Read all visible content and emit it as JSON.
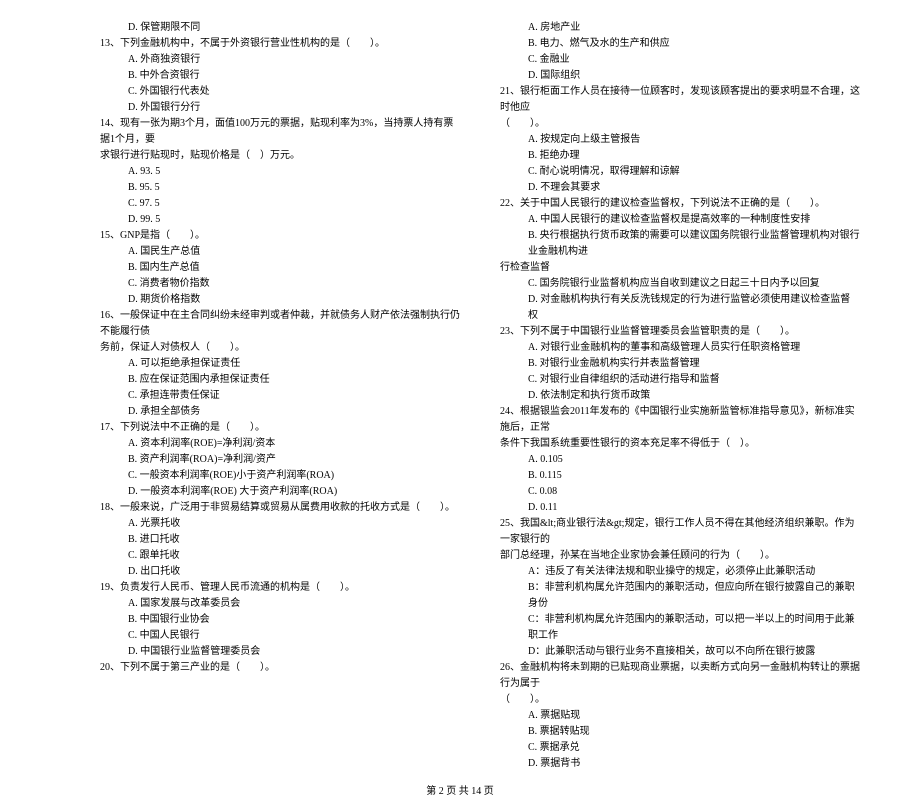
{
  "left": {
    "q12_d": "D. 保管期限不同",
    "q13": "13、下列金融机构中，不属于外资银行营业性机构的是（　　）。",
    "q13_a": "A. 外商独资银行",
    "q13_b": "B. 中外合资银行",
    "q13_c": "C. 外国银行代表处",
    "q13_d": "D. 外国银行分行",
    "q14": "14、现有一张为期3个月，面值100万元的票据，贴现利率为3%，当持票人持有票据1个月，要",
    "q14_cont": "求银行进行贴现时，贴现价格是（　）万元。",
    "q14_a": "A. 93. 5",
    "q14_b": "B. 95. 5",
    "q14_c": "C. 97. 5",
    "q14_d": "D. 99. 5",
    "q15": "15、GNP是指（　　）。",
    "q15_a": "A. 国民生产总值",
    "q15_b": "B. 国内生产总值",
    "q15_c": "C. 消费者物价指数",
    "q15_d": "D. 期货价格指数",
    "q16": "16、一般保证中在主合同纠纷未经审判或者仲裁，并就债务人财产依法强制执行仍不能履行债",
    "q16_cont": "务前，保证人对债权人（　　）。",
    "q16_a": "A. 可以拒绝承担保证责任",
    "q16_b": "B. 应在保证范围内承担保证责任",
    "q16_c": "C. 承担连带责任保证",
    "q16_d": "D. 承担全部债务",
    "q17": "17、下列说法中不正确的是（　　）。",
    "q17_a": "A. 资本利润率(ROE)=净利润/资本",
    "q17_b": "B. 资产利润率(ROA)=净利润/资产",
    "q17_c": "C. 一般资本利润率(ROE)小于资产利润率(ROA)",
    "q17_d": "D. 一般资本利润率(ROE) 大于资产利润率(ROA)",
    "q18": "18、一般来说，广泛用于非贸易结算或贸易从属费用收款的托收方式是（　　）。",
    "q18_a": "A. 光票托收",
    "q18_b": "B. 进口托收",
    "q18_c": "C. 跟单托收",
    "q18_d": "D. 出口托收",
    "q19": "19、负责发行人民币、管理人民币流通的机构是（　　）。",
    "q19_a": "A. 国家发展与改革委员会",
    "q19_b": "B. 中国银行业协会",
    "q19_c": "C. 中国人民银行",
    "q19_d": "D. 中国银行业监督管理委员会",
    "q20": "20、下列不属于第三产业的是（　　）。"
  },
  "right": {
    "q20_a": "A. 房地产业",
    "q20_b": "B. 电力、燃气及水的生产和供应",
    "q20_c": "C. 金融业",
    "q20_d": "D. 国际组织",
    "q21": "21、银行柜面工作人员在接待一位顾客时，发现该顾客提出的要求明显不合理，这时他应",
    "q21_cont": "（　　）。",
    "q21_a": "A. 按规定向上级主管报告",
    "q21_b": "B. 拒绝办理",
    "q21_c": "C. 耐心说明情况，取得理解和谅解",
    "q21_d": "D. 不理会其要求",
    "q22": "22、关于中国人民银行的建议检查监督权，下列说法不正确的是（　　）。",
    "q22_a": "A. 中国人民银行的建议检查监督权是提高效率的一种制度性安排",
    "q22_b": "B. 央行根据执行货币政策的需要可以建议国务院银行业监督管理机构对银行业金融机构进",
    "q22_b_cont": "行检查监督",
    "q22_c": "C. 国务院银行业监督机构应当自收到建议之日起三十日内予以回复",
    "q22_d": "D. 对金融机构执行有关反洗钱规定的行为进行监管必须使用建议检查监督权",
    "q23": "23、下列不属于中国银行业监督管理委员会监管职责的是（　　）。",
    "q23_a": "A. 对银行业金融机构的董事和高级管理人员实行任职资格管理",
    "q23_b": "B. 对银行业金融机构实行并表监督管理",
    "q23_c": "C. 对银行业自律组织的活动进行指导和监督",
    "q23_d": "D. 依法制定和执行货币政策",
    "q24": "24、根据银监会2011年发布的《中国银行业实施新监管标准指导意见》，新标准实施后，正常",
    "q24_cont": "条件下我国系统重要性银行的资本充足率不得低于（　）。",
    "q24_a": "A. 0.105",
    "q24_b": "B. 0.115",
    "q24_c": "C. 0.08",
    "q24_d": "D. 0.11",
    "q25": "25、我国&lt;商业银行法&gt;规定，银行工作人员不得在其他经济组织兼职。作为一家银行的",
    "q25_cont": "部门总经理，孙某在当地企业家协会兼任顾问的行为（　　）。",
    "q25_a": "A：违反了有关法律法规和职业操守的规定，必须停止此兼职活动",
    "q25_b": "B：非营利机构属允许范围内的兼职活动，但应向所在银行披露自己的兼职身份",
    "q25_c": "C：非营利机构属允许范围内的兼职活动，可以把一半以上的时间用于此兼职工作",
    "q25_d": "D：此兼职活动与银行业务不直接相关，故可以不向所在银行披露",
    "q26": "26、金融机构将未到期的已贴现商业票据，以卖断方式向另一金融机构转让的票据行为属于",
    "q26_cont": "（　　）。",
    "q26_a": "A. 票据贴现",
    "q26_b": "B. 票据转贴现",
    "q26_c": "C. 票据承兑",
    "q26_d": "D. 票据背书"
  },
  "footer": "第 2 页 共 14 页"
}
